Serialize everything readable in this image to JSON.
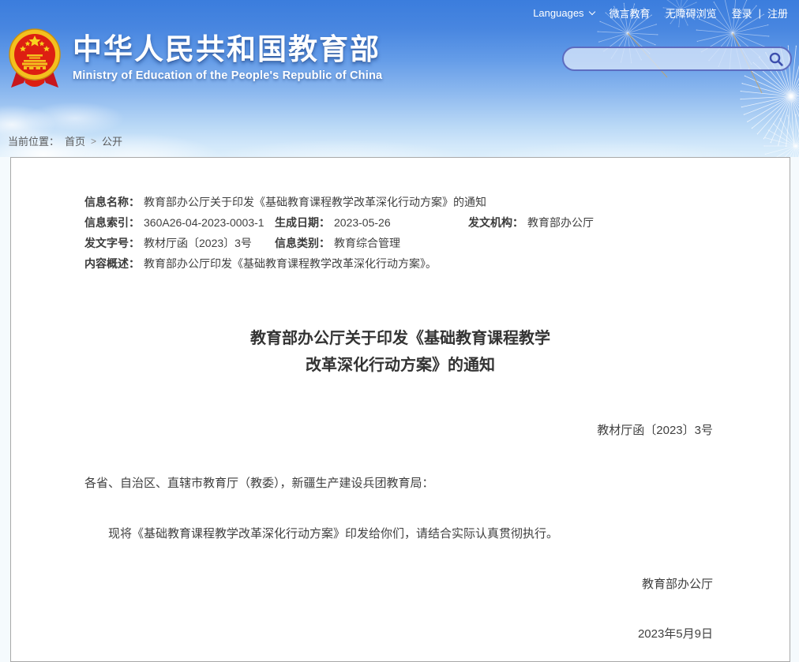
{
  "topbar": {
    "languages": "Languages",
    "wechat": "微言教育",
    "accessibility": "无障碍浏览",
    "login": "登录",
    "divider": "|",
    "register": "注册"
  },
  "header": {
    "title": "中华人民共和国教育部",
    "subtitle": "Ministry of Education of the People's Republic of China",
    "search_value": ""
  },
  "breadcrumb": {
    "prefix": "当前位置：",
    "home": "首页",
    "separator": ">",
    "current": "公开"
  },
  "doc": {
    "meta": {
      "name_label": "信息名称：",
      "name_value": "教育部办公厅关于印发《基础教育课程教学改革深化行动方案》的通知",
      "index_label": "信息索引：",
      "index_value": "360A26-04-2023-0003-1",
      "gen_date_label": "生成日期：",
      "gen_date_value": "2023-05-26",
      "agency_label": "发文机构：",
      "agency_value": "教育部办公厅",
      "number_label": "发文字号：",
      "number_value": "教材厅函〔2023〕3号",
      "category_label": "信息类别：",
      "category_value": "教育综合管理",
      "summary_label": "内容概述：",
      "summary_value": "教育部办公厅印发《基础教育课程教学改革深化行动方案》。"
    },
    "title_line1": "教育部办公厅关于印发《基础教育课程教学",
    "title_line2": "改革深化行动方案》的通知",
    "doc_number": "教材厅函〔2023〕3号",
    "salutation": "各省、自治区、直辖市教育厅（教委），新疆生产建设兵团教育局：",
    "body": "现将《基础教育课程教学改革深化行动方案》印发给你们，请结合实际认真贯彻执行。",
    "signer": "教育部办公厅",
    "date": "2023年5月9日"
  },
  "colors": {
    "sky_top": "#3b7ddd",
    "search_border": "#5d6cc0",
    "text": "#404040",
    "emblem_red": "#dd1f12",
    "emblem_gold": "#f4c01e"
  }
}
